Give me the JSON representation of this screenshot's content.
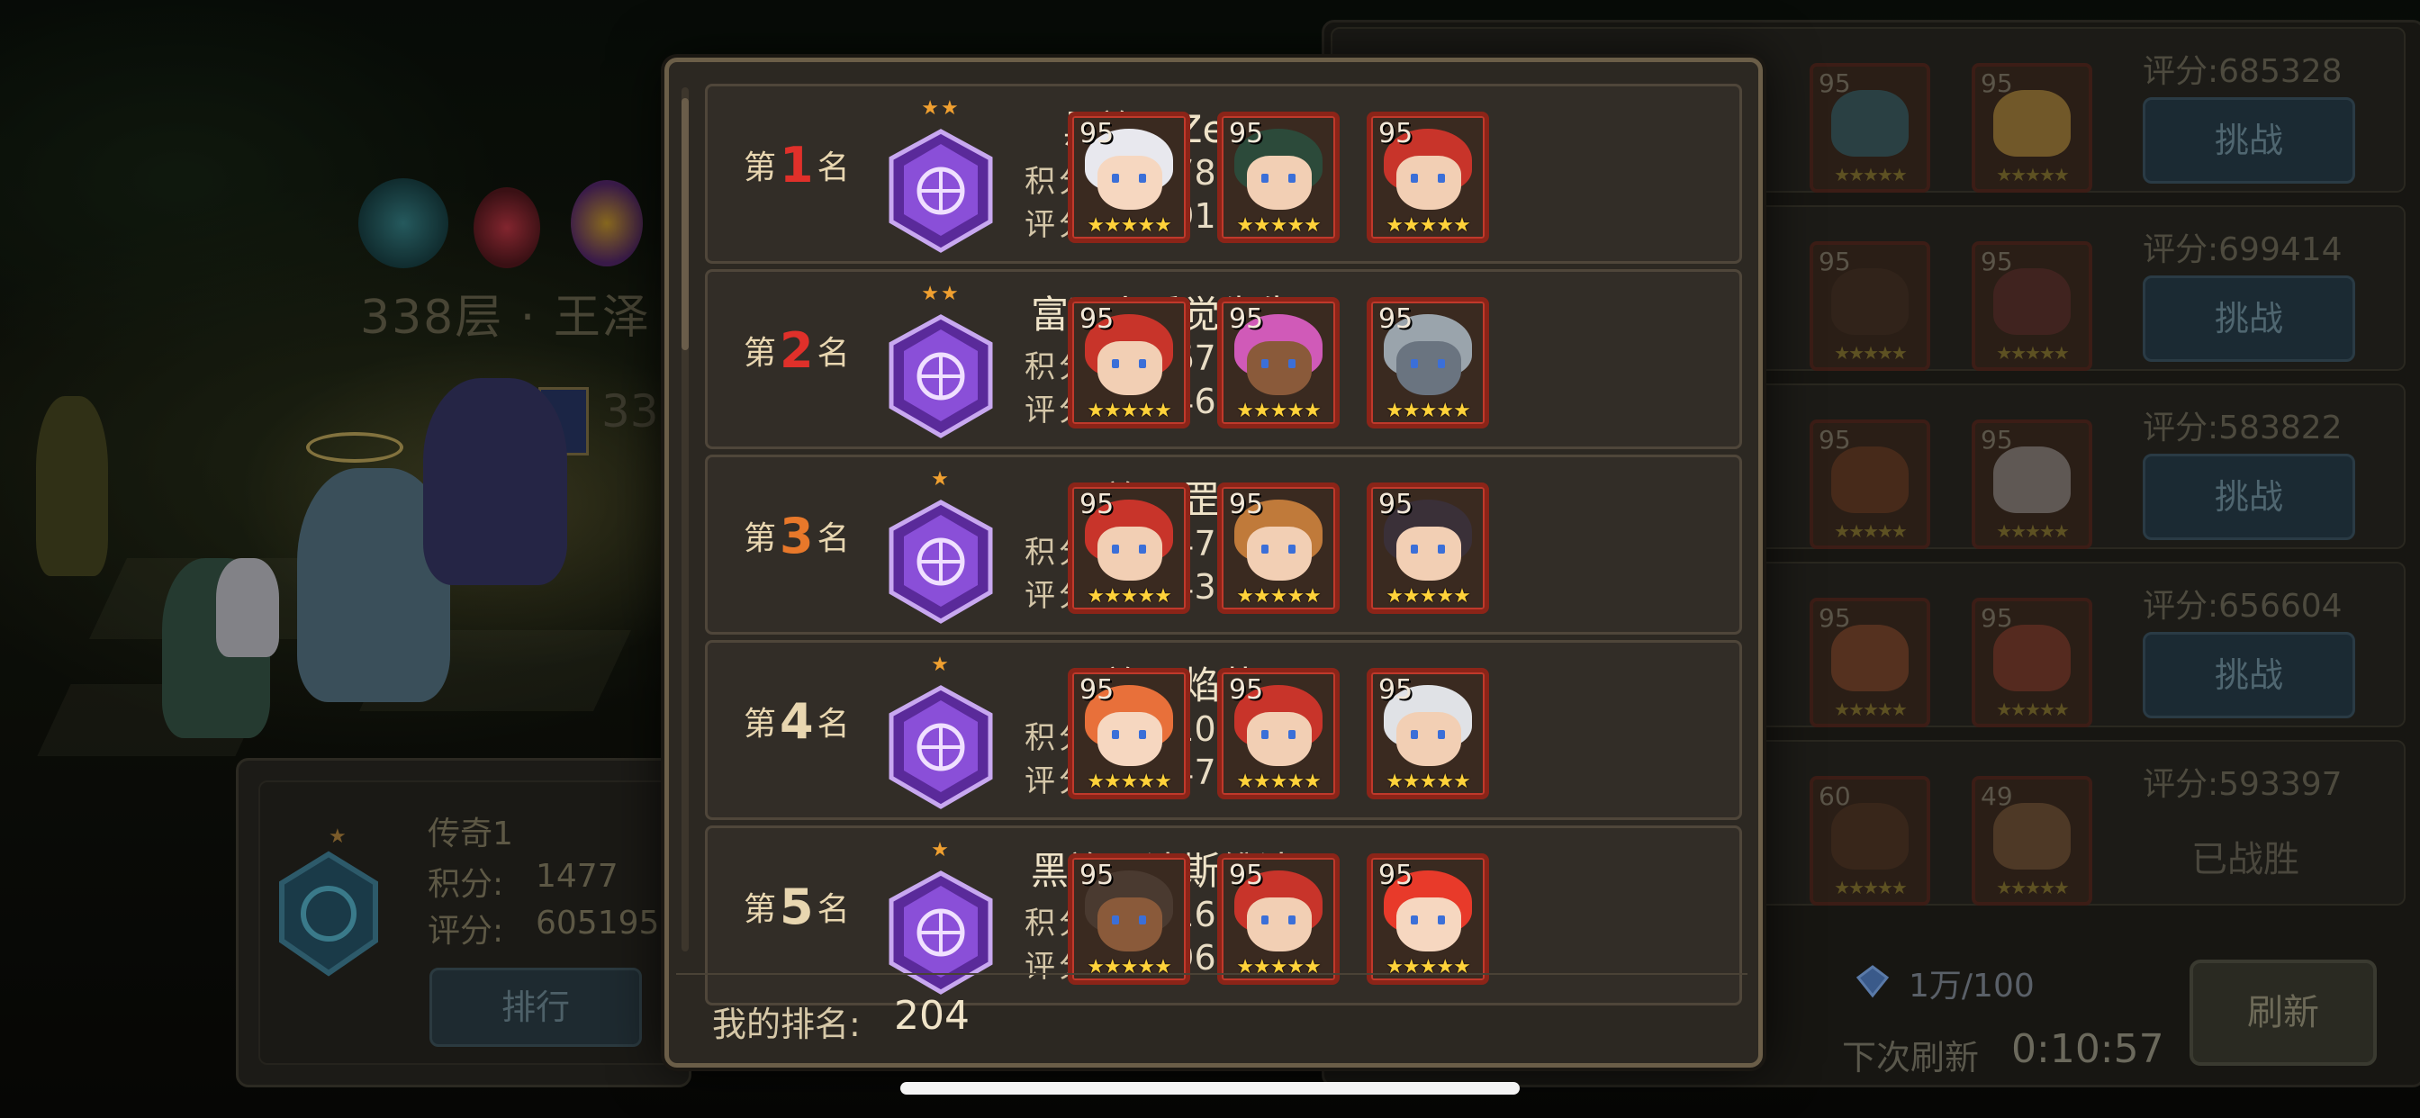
{
  "background": {
    "floor_label": "338层 · 王泽",
    "floor_label_short": "338"
  },
  "left_panel": {
    "tier": "传奇1",
    "points_label": "积分:",
    "points": "1477",
    "score_label": "评分:",
    "score": "605195",
    "rank_button": "排行"
  },
  "opponents": {
    "items": [
      {
        "score": "评分:685328",
        "action": "挑战",
        "levels": [
          "95",
          "95"
        ]
      },
      {
        "score": "评分:699414",
        "action": "挑战",
        "levels": [
          "95",
          "95"
        ]
      },
      {
        "score": "评分:583822",
        "action": "挑战",
        "levels": [
          "95",
          "95"
        ]
      },
      {
        "score": "评分:656604",
        "action": "挑战",
        "levels": [
          "95",
          "95"
        ]
      },
      {
        "score": "评分:593397",
        "action": "已战胜",
        "levels": [
          "60",
          "49"
        ]
      }
    ],
    "refresh_cost": "1万/100",
    "next_refresh_label": "下次刷新",
    "timer": "0:10:57",
    "refresh_button": "刷新"
  },
  "ranking": {
    "rank_prefix": "第",
    "rank_suffix": "名",
    "points_label": "积分:",
    "score_label": "评分:",
    "rows": [
      {
        "rank": "1",
        "rank_color": "#e0302a",
        "name": "黑袍丶Zero",
        "points": "2578",
        "score": "1091892",
        "stars": "★★",
        "heroes": [
          {
            "level": "95",
            "hair": "#e8e8ee",
            "skin": "#f6d7c0"
          },
          {
            "level": "95",
            "hair": "#2c4a3a",
            "skin": "#f2cfb4"
          },
          {
            "level": "95",
            "hair": "#c8342a",
            "skin": "#f2cfb4"
          }
        ]
      },
      {
        "rank": "2",
        "rank_color": "#e0302a",
        "name": "富强丨睡觉先生",
        "points": "2467",
        "score": "1146886",
        "stars": "★★",
        "heroes": [
          {
            "level": "95",
            "hair": "#c8342a",
            "skin": "#f2cfb4"
          },
          {
            "level": "95",
            "hair": "#d05ab8",
            "skin": "#8a5a3a"
          },
          {
            "level": "95",
            "hair": "#9aa4ac",
            "skin": "#6a7480"
          }
        ]
      },
      {
        "rank": "3",
        "rank_color": "#e8782a",
        "name": "黑袍丶罡子",
        "points": "2447",
        "score": "924378",
        "stars": "★",
        "heroes": [
          {
            "level": "95",
            "hair": "#c8342a",
            "skin": "#f2cfb4"
          },
          {
            "level": "95",
            "hair": "#c07a3a",
            "skin": "#f2cfb4"
          },
          {
            "level": "95",
            "hair": "#3a3038",
            "skin": "#f2cfb4"
          }
        ]
      },
      {
        "rank": "4",
        "rank_color": "#e8d6b0",
        "name": "黑袍丶焰蓝",
        "points": "2410",
        "score": "974765",
        "stars": "★",
        "heroes": [
          {
            "level": "95",
            "hair": "#e8703a",
            "skin": "#f6d7c0"
          },
          {
            "level": "95",
            "hair": "#c8342a",
            "skin": "#f2cfb4"
          },
          {
            "level": "95",
            "hair": "#e0e2e6",
            "skin": "#f2cfb4"
          }
        ]
      },
      {
        "rank": "5",
        "rank_color": "#e8d6b0",
        "name": "黑袍丶达斯维达",
        "points": "2216",
        "score": "779685",
        "stars": "★",
        "heroes": [
          {
            "level": "95",
            "hair": "#4a3a30",
            "skin": "#8a5a3a"
          },
          {
            "level": "95",
            "hair": "#c8342a",
            "skin": "#f2cfb4"
          },
          {
            "level": "95",
            "hair": "#e83a2a",
            "skin": "#f6d7c0"
          }
        ]
      }
    ],
    "my_rank_label": "我的排名:",
    "my_rank": "204"
  },
  "colors": {
    "modal_border": "#6b5e48",
    "hero_frame": "#8b2418",
    "star": "#ffd23a",
    "emblem": "#8a4fd8"
  }
}
